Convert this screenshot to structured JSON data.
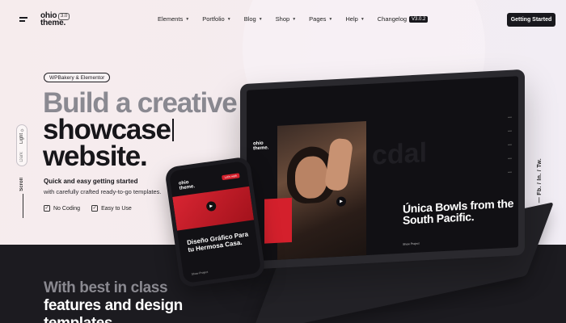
{
  "header": {
    "logo_line1": "ohio",
    "logo_line2": "theme.",
    "logo_version": "3.0",
    "nav": [
      {
        "label": "Elements"
      },
      {
        "label": "Portfolio"
      },
      {
        "label": "Blog"
      },
      {
        "label": "Shop"
      },
      {
        "label": "Pages"
      },
      {
        "label": "Help"
      },
      {
        "label": "Changelog",
        "badge": "V3.0.2"
      }
    ],
    "cta": "Getting Started"
  },
  "hero": {
    "pill": "WPBakery & Elementor",
    "line1": "Build a creative",
    "line2": "showcase",
    "line3": "website.",
    "sub_strong": "Quick and easy getting started",
    "sub_text": "with carefully crafted ready-to-go templates.",
    "checks": [
      "No Coding",
      "Easy to Use"
    ]
  },
  "side": {
    "light": "Light",
    "dark": "Dark",
    "scroll": "Scroll",
    "social": "Follow Us — Fb. / In. / Tw."
  },
  "band": {
    "line1": "With best in class",
    "line2": "features and design",
    "line3": "templates"
  },
  "laptop": {
    "logo_line1": "ohio",
    "logo_line2": "theme.",
    "watermark": "cdal",
    "title": "Única Bowls from the South Pacific.",
    "link": "Show Project"
  },
  "phone": {
    "logo_line1": "ohio",
    "logo_line2": "theme.",
    "button": "Let's work",
    "title": "Diseño Gráfico Para tu Hermosa Casa.",
    "link": "Show Project"
  },
  "colors": {
    "accent": "#d4202c",
    "dark": "#1c1b20",
    "bg": "#f6eced"
  },
  "icons": {
    "menu": "hamburger-icon",
    "theme": "sun-icon",
    "check": "checkbox-icon",
    "play": "play-icon"
  }
}
